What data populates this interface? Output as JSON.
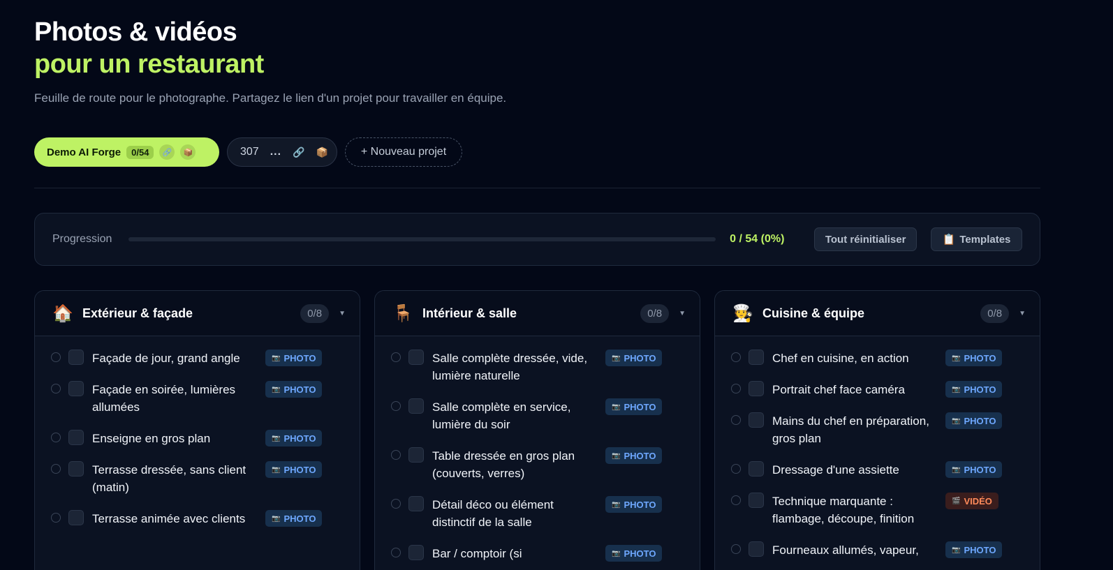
{
  "header": {
    "title_line1": "Photos & vidéos",
    "title_line2": "pour un restaurant",
    "subtitle": "Feuille de route pour le photographe. Partagez le lien d'un projet pour travailler en équipe."
  },
  "projects": {
    "active": {
      "name": "Demo AI Forge",
      "count": "0/54",
      "icons": [
        "link-icon",
        "box-icon"
      ]
    },
    "other": {
      "name": "307",
      "more": "...",
      "icons": [
        "link-icon",
        "box-icon"
      ]
    },
    "new_label": "+ Nouveau projet"
  },
  "progress": {
    "label": "Progression",
    "text": "0 / 54 (0%)",
    "fraction": 0,
    "reset_label": "Tout réinitialiser",
    "templates_label": "Templates",
    "templates_icon": "clipboard-icon"
  },
  "colors": {
    "accent": "#bef264",
    "background": "#030817",
    "photo_badge": "#6ea8ff",
    "video_badge": "#ff8a5a"
  },
  "columns": [
    {
      "emoji": "🏠",
      "icon": "house-icon",
      "title": "Extérieur & façade",
      "count": "0/8",
      "items": [
        {
          "text": "Façade de jour, grand angle",
          "badge": "PHOTO",
          "type": "photo"
        },
        {
          "text": "Façade en soirée, lumières allumées",
          "badge": "PHOTO",
          "type": "photo"
        },
        {
          "text": "Enseigne en gros plan",
          "badge": "PHOTO",
          "type": "photo"
        },
        {
          "text": "Terrasse dressée, sans client (matin)",
          "badge": "PHOTO",
          "type": "photo"
        },
        {
          "text": "Terrasse animée avec clients",
          "badge": "PHOTO",
          "type": "photo"
        }
      ]
    },
    {
      "emoji": "🪑",
      "icon": "chair-icon",
      "title": "Intérieur & salle",
      "count": "0/8",
      "items": [
        {
          "text": "Salle complète dressée, vide, lumière naturelle",
          "badge": "PHOTO",
          "type": "photo"
        },
        {
          "text": "Salle complète en service, lumière du soir",
          "badge": "PHOTO",
          "type": "photo"
        },
        {
          "text": "Table dressée en gros plan (couverts, verres)",
          "badge": "PHOTO",
          "type": "photo"
        },
        {
          "text": "Détail déco ou élément distinctif de la salle",
          "badge": "PHOTO",
          "type": "photo"
        },
        {
          "text": "Bar / comptoir (si",
          "badge": "PHOTO",
          "type": "photo"
        }
      ]
    },
    {
      "emoji": "🧑‍🍳",
      "icon": "chef-icon",
      "title": "Cuisine & équipe",
      "count": "0/8",
      "items": [
        {
          "text": "Chef en cuisine, en action",
          "badge": "PHOTO",
          "type": "photo"
        },
        {
          "text": "Portrait chef face caméra",
          "badge": "PHOTO",
          "type": "photo"
        },
        {
          "text": "Mains du chef en préparation, gros plan",
          "badge": "PHOTO",
          "type": "photo"
        },
        {
          "text": "Dressage d'une assiette",
          "badge": "PHOTO",
          "type": "photo"
        },
        {
          "text": "Technique marquante : flambage, découpe, finition",
          "badge": "VIDÉO",
          "type": "video"
        },
        {
          "text": "Fourneaux allumés, vapeur,",
          "badge": "PHOTO",
          "type": "photo"
        }
      ]
    }
  ]
}
